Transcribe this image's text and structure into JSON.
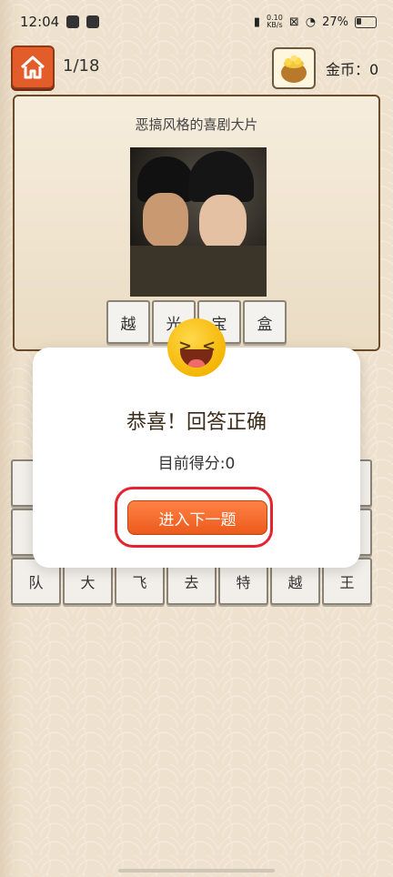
{
  "status": {
    "time": "12:04",
    "net_speed_value": "0.10",
    "net_speed_unit": "KB/s",
    "battery": "27%"
  },
  "header": {
    "level": "1/18",
    "coins": "金币：0"
  },
  "question": {
    "hint": "恶搞风格的喜剧大片",
    "answer_slots": [
      "越",
      "光",
      "宝",
      "盒"
    ]
  },
  "options": {
    "row1": [
      "",
      "",
      "",
      "",
      "",
      "",
      ""
    ],
    "row2": [
      "",
      "",
      "",
      "",
      "",
      "",
      ""
    ],
    "row3": [
      "队",
      "大",
      "飞",
      "去",
      "特",
      "越",
      "王"
    ]
  },
  "modal": {
    "title": "恭喜！回答正确",
    "score": "目前得分:0",
    "next_button": "进入下一题"
  },
  "colors": {
    "accent": "#ec5a1c",
    "highlight": "#e5242f"
  }
}
